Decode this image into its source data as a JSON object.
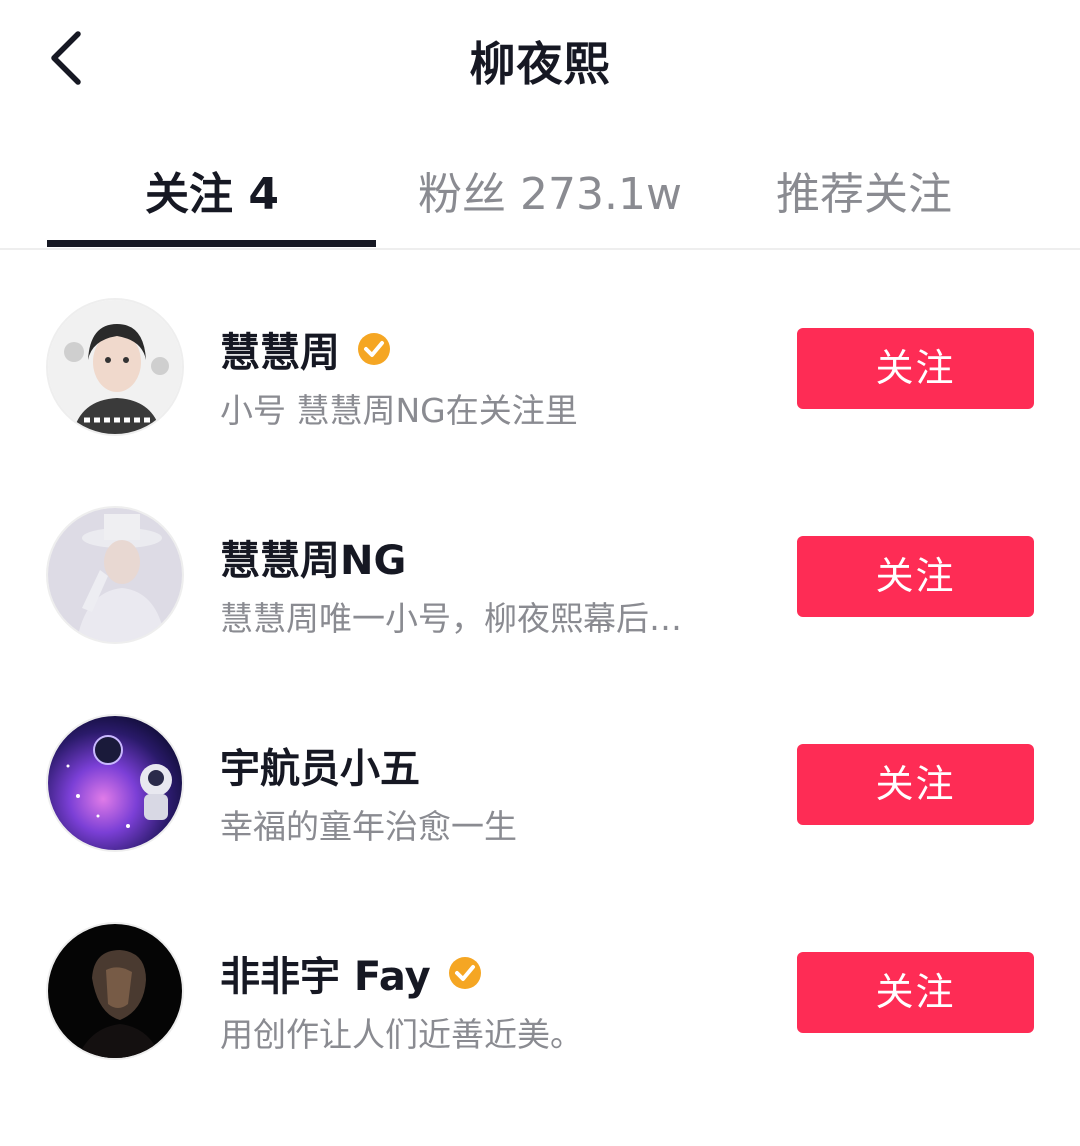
{
  "header": {
    "title": "柳夜熙",
    "back_icon": "chevron-left-icon"
  },
  "tabs": [
    {
      "label": "关注 4",
      "active": true
    },
    {
      "label": "粉丝 273.1w",
      "active": false
    },
    {
      "label": "推荐关注",
      "active": false
    }
  ],
  "colors": {
    "accent": "#fe2c55",
    "verified": "#f5a623",
    "text_primary": "#161823",
    "text_secondary": "#8a8b91"
  },
  "users": [
    {
      "name": "慧慧周",
      "verified": true,
      "bio": "小号 慧慧周NG在关注里",
      "button": "关注"
    },
    {
      "name": "慧慧周NG",
      "verified": false,
      "bio": "慧慧周唯一小号，柳夜熙幕后…",
      "button": "关注"
    },
    {
      "name": "宇航员小五",
      "verified": false,
      "bio": "幸福的童年治愈一生",
      "button": "关注"
    },
    {
      "name": "非非宇 Fay",
      "verified": true,
      "bio": "用创作让人们近善近美。",
      "button": "关注"
    }
  ]
}
